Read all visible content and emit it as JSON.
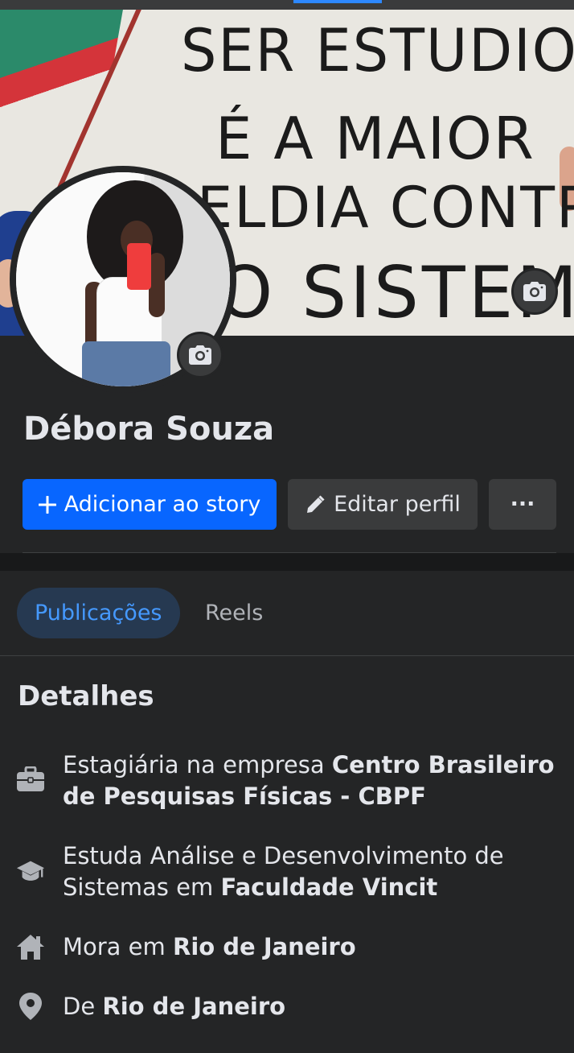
{
  "profile": {
    "name": "Débora Souza"
  },
  "actions": {
    "add_story": "Adicionar ao story",
    "edit_profile": "Editar perfil",
    "more": "···"
  },
  "cover_text": {
    "line1": "SER ESTUDIOSO",
    "line2": "É A MAIOR",
    "line3": "BELDIA CONTRA",
    "line4": "O SISTEMA"
  },
  "tabs": [
    {
      "label": "Publicações",
      "active": true
    },
    {
      "label": "Reels",
      "active": false
    }
  ],
  "details": {
    "title": "Detalhes",
    "work": {
      "prefix": "Estagiária na empresa ",
      "org": "Centro Brasileiro de Pesquisas Físicas - CBPF",
      "icon": "briefcase-icon"
    },
    "education": {
      "prefix": "Estuda Análise e Desenvolvimento de Sistemas em ",
      "org": "Faculdade Vincit",
      "icon": "graduation-cap-icon"
    },
    "lives": {
      "prefix": "Mora em ",
      "place": "Rio de Janeiro",
      "icon": "home-icon"
    },
    "from": {
      "prefix": "De ",
      "place": "Rio de Janeiro",
      "icon": "location-pin-icon"
    }
  },
  "colors": {
    "background": "#242526",
    "primary_button": "#0866ff",
    "secondary_button": "#3a3b3c",
    "active_tab_bg": "#263951",
    "active_tab_text": "#4599ff"
  }
}
